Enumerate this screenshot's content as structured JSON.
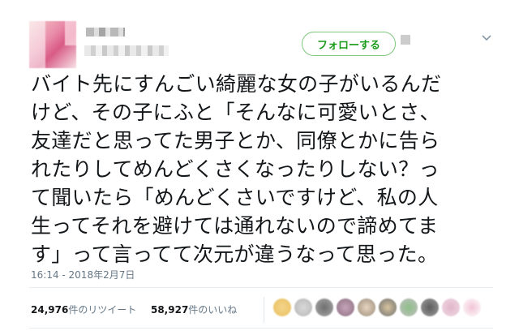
{
  "follow_button": {
    "label": "フォローする"
  },
  "tweet": {
    "lines": [
      "バイト先にすんごい綺麗な女の子がいるんだ",
      "けど、その子にふと「そんなに可愛いとさ、",
      "友達だと思ってた男子とか、同僚とかに告ら",
      "れたりしてめんどくさくなったりしない？っ",
      "て聞いたら「めんどくさいですけど、私の人",
      "生ってそれを避けては通れないので諦めてま",
      "す」って言ってて次元が違うなって思った。"
    ],
    "timestamp": "16:14 - 2018年2月7日"
  },
  "stats": {
    "retweets_count": "24,976",
    "retweets_label": "件のリツイート",
    "likes_count": "58,927",
    "likes_label": "件のいいね"
  },
  "colors": {
    "follow_green": "#1a9b1a",
    "text": "#14171a",
    "muted": "#657786"
  }
}
